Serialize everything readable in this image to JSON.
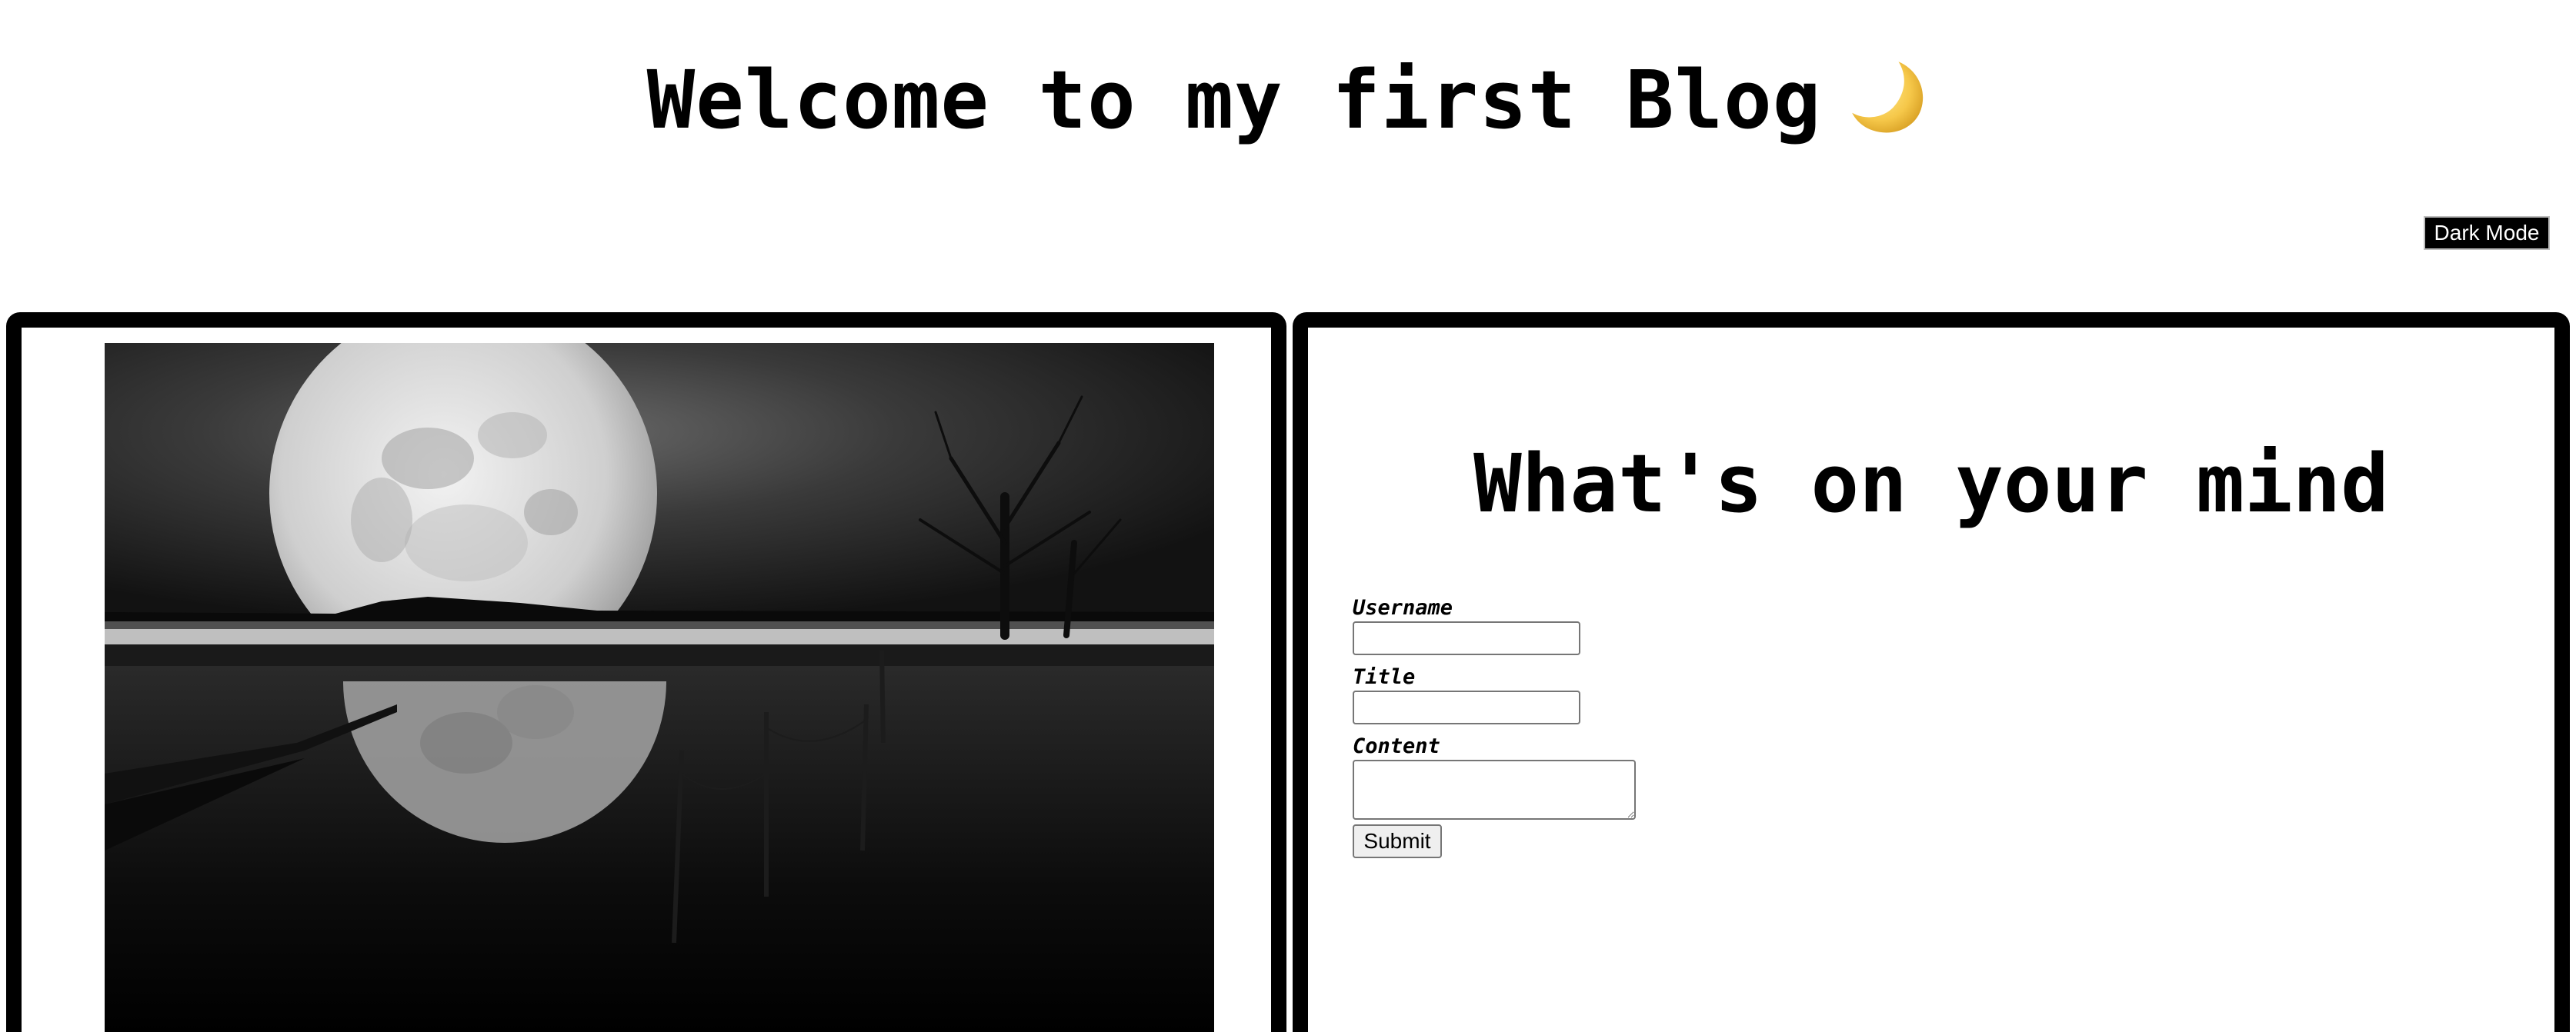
{
  "header": {
    "title": "Welcome to my first Blog",
    "title_icon": "crescent-moon-emoji",
    "dark_mode_label": "Dark Mode"
  },
  "left_panel": {
    "image": "full-moon-over-water-black-and-white"
  },
  "form": {
    "heading": "What's on your mind",
    "username_label": "Username",
    "username_value": "",
    "title_label": "Title",
    "title_value": "",
    "content_label": "Content",
    "content_value": "",
    "submit_label": "Submit"
  },
  "colors": {
    "background": "#ffffff",
    "text": "#000000",
    "panel_border": "#000000",
    "dark_mode_button_bg": "#000000",
    "dark_mode_button_text": "#ffffff",
    "moon_emoji": "#f3c84a"
  }
}
